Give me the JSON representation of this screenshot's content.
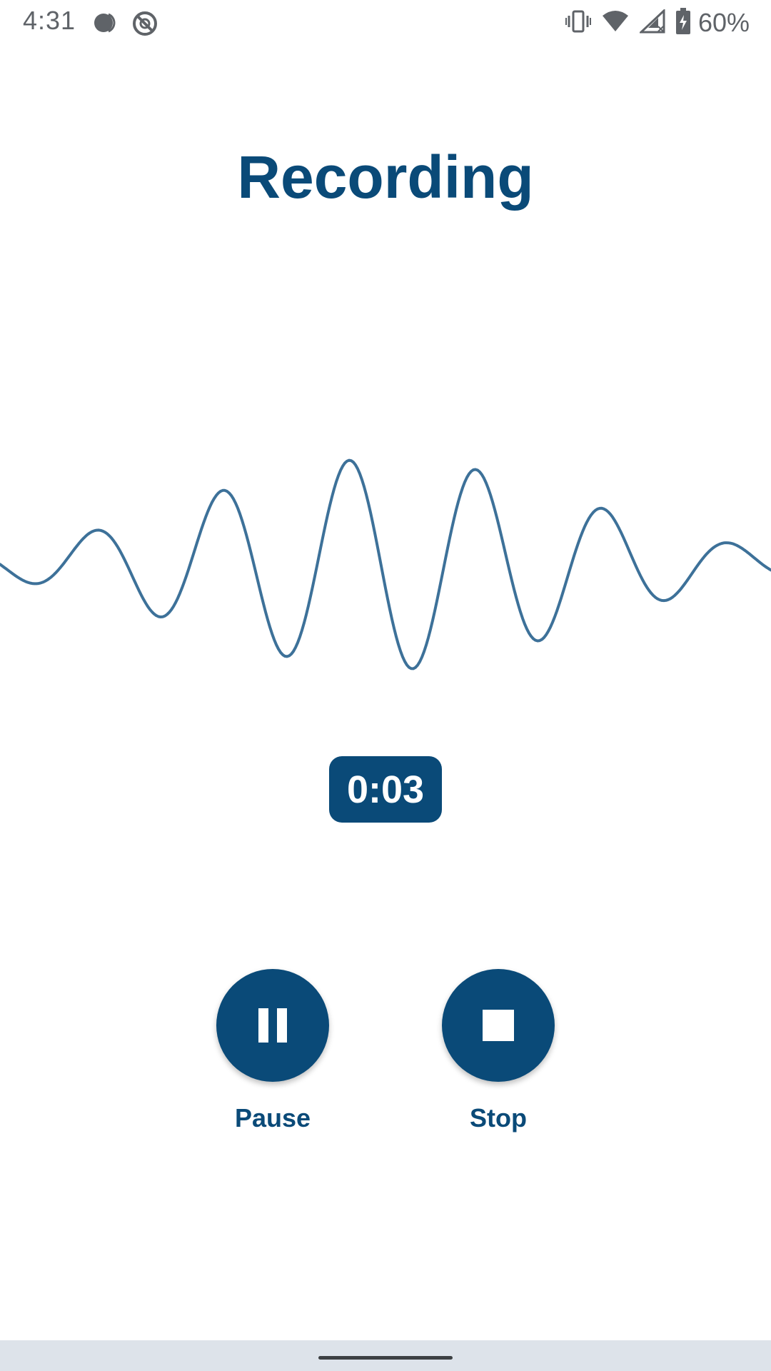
{
  "status_bar": {
    "time": "4:31",
    "battery": "60%",
    "icons": [
      "moon-icon",
      "no-sync-icon",
      "vibrate-icon",
      "wifi-icon",
      "signal-icon",
      "battery-icon"
    ]
  },
  "title": "Recording",
  "timer": "0:03",
  "controls": {
    "pause_label": "Pause",
    "stop_label": "Stop"
  },
  "colors": {
    "primary": "#0a4a78",
    "waveform": "#3d7199",
    "status_text": "#5f6368",
    "nav_bar": "#dde3ea"
  }
}
